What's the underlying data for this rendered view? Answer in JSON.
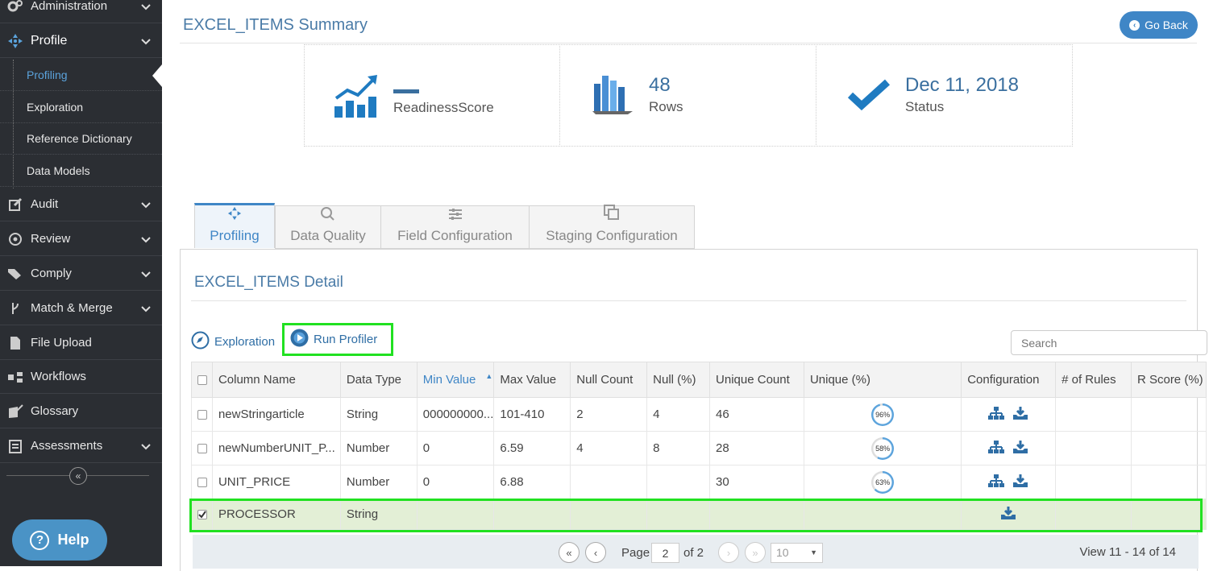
{
  "sidebar": {
    "items": [
      {
        "label": "Administration",
        "icon": "gears-icon"
      },
      {
        "label": "Profile",
        "icon": "crosshair-icon"
      },
      {
        "label": "Audit",
        "icon": "edit-icon"
      },
      {
        "label": "Review",
        "icon": "compass-icon"
      },
      {
        "label": "Comply",
        "icon": "tags-icon"
      },
      {
        "label": "Match & Merge",
        "icon": "branch-icon"
      },
      {
        "label": "File Upload",
        "icon": "file-icon"
      },
      {
        "label": "Workflows",
        "icon": "workflow-icon"
      },
      {
        "label": "Glossary",
        "icon": "book-edit-icon"
      },
      {
        "label": "Assessments",
        "icon": "clipboard-icon"
      }
    ],
    "profile_sub": [
      "Profiling",
      "Exploration",
      "Reference Dictionary",
      "Data Models"
    ],
    "help_label": "Help"
  },
  "header": {
    "title": "EXCEL_ITEMS Summary",
    "go_back": "Go Back"
  },
  "stats": {
    "readiness_label": "ReadinessScore",
    "rows_value": "48",
    "rows_label": "Rows",
    "status_value": "Dec 11, 2018",
    "status_label": "Status"
  },
  "tabs": [
    "Profiling",
    "Data Quality",
    "Field Configuration",
    "Staging Configuration"
  ],
  "detail": {
    "title": "EXCEL_ITEMS Detail",
    "exploration": "Exploration",
    "run_profiler": "Run Profiler",
    "search_placeholder": "Search"
  },
  "table": {
    "headers": [
      "Column Name",
      "Data Type",
      "Min Value",
      "Max Value",
      "Null Count",
      "Null (%)",
      "Unique Count",
      "Unique (%)",
      "Configuration",
      "# of Rules",
      "R Score (%)"
    ],
    "rows": [
      {
        "name": "newStringarticle",
        "type": "String",
        "min": "000000000...",
        "max": "101-410",
        "null_count": "2",
        "null_pct": "4",
        "unique_count": "46",
        "unique_pct": "96%",
        "checked": false
      },
      {
        "name": "newNumberUNIT_P...",
        "type": "Number",
        "min": "0",
        "max": "6.59",
        "null_count": "4",
        "null_pct": "8",
        "unique_count": "28",
        "unique_pct": "58%",
        "checked": false
      },
      {
        "name": "UNIT_PRICE",
        "type": "Number",
        "min": "0",
        "max": "6.88",
        "null_count": "",
        "null_pct": "",
        "unique_count": "30",
        "unique_pct": "63%",
        "checked": false
      },
      {
        "name": "PROCESSOR",
        "type": "String",
        "min": "",
        "max": "",
        "null_count": "",
        "null_pct": "",
        "unique_count": "",
        "unique_pct": "",
        "checked": true
      }
    ]
  },
  "pager": {
    "page_label": "Page",
    "page": "2",
    "of_label": "of 2",
    "page_size": "10",
    "view_text": "View 11 - 14 of 14"
  },
  "colors": {
    "accent": "#3f86c6",
    "highlight": "#21e121",
    "sidebar": "#2b2e33"
  }
}
